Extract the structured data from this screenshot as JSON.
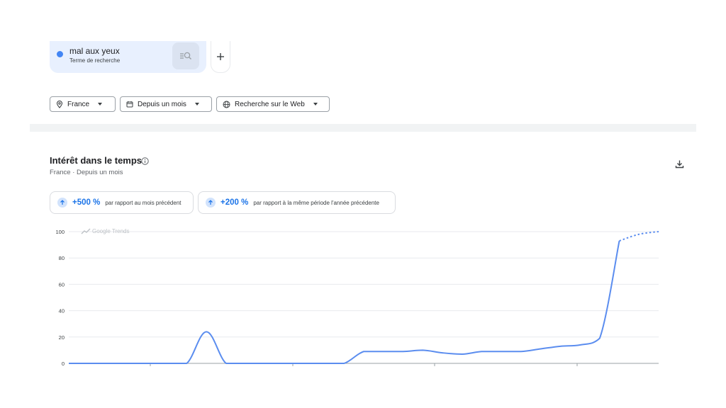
{
  "search_term": {
    "name": "mal aux yeux",
    "subtitle": "Terme de recherche",
    "color": "#4285f4",
    "compare_icon": "search-compare-icon",
    "add_icon": "plus-icon"
  },
  "filters": [
    {
      "label": "France",
      "icon": "location-pin-icon"
    },
    {
      "label": "Depuis un mois",
      "icon": "calendar-icon"
    },
    {
      "label": "Recherche sur le Web",
      "icon": "globe-icon"
    }
  ],
  "section": {
    "title": "Intérêt dans le temps",
    "subtitle": "France · Depuis un mois",
    "info_icon": "info-icon",
    "download_icon": "download-icon"
  },
  "stats": [
    {
      "value": "+500 %",
      "text": "par rapport au mois précédent"
    },
    {
      "value": "+200 %",
      "text": "par rapport à la même période l'année précédente"
    }
  ],
  "chart": {
    "watermark": "Google Trends"
  },
  "chart_data": {
    "type": "line",
    "title": "",
    "xlabel": "",
    "ylabel": "",
    "ylim": [
      0,
      100
    ],
    "yticks": [
      0,
      20,
      40,
      60,
      80,
      100
    ],
    "grid": true,
    "line_color": "#5b8def",
    "series": [
      {
        "x": [
          0,
          1,
          2,
          3,
          4,
          5,
          6,
          7,
          8,
          9,
          10,
          11,
          12,
          13,
          14,
          15,
          16,
          17,
          18,
          19,
          20,
          21,
          22,
          23,
          24,
          25,
          26,
          27,
          28,
          29,
          30
        ],
        "values": [
          0,
          0,
          0,
          0,
          0,
          0,
          0,
          24,
          0,
          0,
          0,
          0,
          0,
          0,
          0,
          9,
          9,
          9,
          10,
          8,
          7,
          9,
          9,
          9,
          11,
          13,
          14,
          19,
          93,
          98,
          100
        ],
        "partial_from_index": 28
      }
    ]
  }
}
